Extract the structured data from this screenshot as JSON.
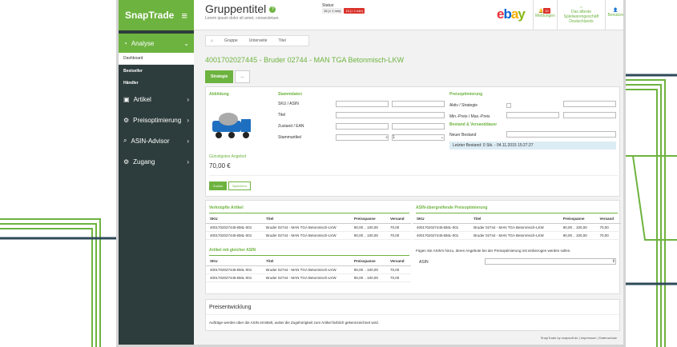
{
  "app": {
    "brand": "SnapTrade"
  },
  "sidebar": {
    "active": "Analyse",
    "sub": [
      "Dashboard",
      "Bestseller",
      "Händler"
    ],
    "items": [
      "Artikel",
      "Preisoptimierung",
      "ASIN-Advisor",
      "Zugang"
    ]
  },
  "header": {
    "title": "Gruppentitel",
    "subtitle": "Lorem ipsum dolor sit amet, consectetuer.",
    "status_label": "Status:",
    "badge1": "15 (> 1 min)",
    "badge2": "15 (> 1 min)",
    "ebay": "ebay",
    "notif_count": "42",
    "notif_label": "Meldungen",
    "shop_label": "Das älteste Spielwarengeschäft Deutschlands",
    "user_label": "Benutzer"
  },
  "breadcrumb": [
    "Gruppe",
    "Unterseite",
    "Titel"
  ],
  "page": {
    "heading": "4001702027445 - Bruder 02744 - MAN TGA Betonmisch-LKW"
  },
  "tabs": [
    "Strategie",
    "..."
  ],
  "strategy": {
    "abbildung": "Abbildung",
    "stammdaten": "Stammdaten",
    "preisopt": "Preisoptimierung",
    "bestand": "Bestand & Versanddauer",
    "fields": [
      "SKU / ASIN",
      "Titel",
      "Zustand / EAN",
      "Stammartikel"
    ],
    "preis_fields": [
      "Aktiv / Strategie",
      "Min.-Preis / Max.-Preis"
    ],
    "neuer_bestand": "Neuer Bestand",
    "letzter": "Letzter Bestand: 0 Stk. - 04.11.2015 15:27:27",
    "guenstig": "Günstigstes Angebot",
    "price": "70,00 €",
    "select_val": "1",
    "back": "Zurück",
    "save": "Speichern"
  },
  "tables": {
    "verknuepft": "Verknüpfte Artikel",
    "gleiche": "Artikel mit gleicher ASIN",
    "asin_title": "ASIN-übergreifende Preisoptimierung",
    "headers": [
      "SKU",
      "Titel",
      "Preisspanne",
      "Versand"
    ],
    "rows": [
      [
        "4001702027445-BML-001",
        "Bruder 02744 - MAN TGA Betonmisch-LKW",
        "90,00 .. 100,00",
        "70,00"
      ],
      [
        "4001702027445-BML-001",
        "Bruder 02744 - MAN TGA Betonmisch-LKW",
        "90,00 .. 100,00",
        "70,00"
      ]
    ],
    "asin_note": "Fügen Sie ASIN's hinzu, deren Angebote bei der Preisoptimierung mit einbezogen werden sollen.",
    "asin_label": "ASIN"
  },
  "preisentwicklung": {
    "title": "Preisentwicklung",
    "text": "Aufträge werden über die ASIN ermittelt, wobei die Zugehörigkeit zum Artikel farblich gekennzeichnet wird."
  },
  "footer": "SnapTrade by snapsoft.de | Impressum | Datenschutz",
  "colors": {
    "accent": "#6db33f",
    "sidebar": "#2d3c3c",
    "deco": "#2e4a5a"
  }
}
